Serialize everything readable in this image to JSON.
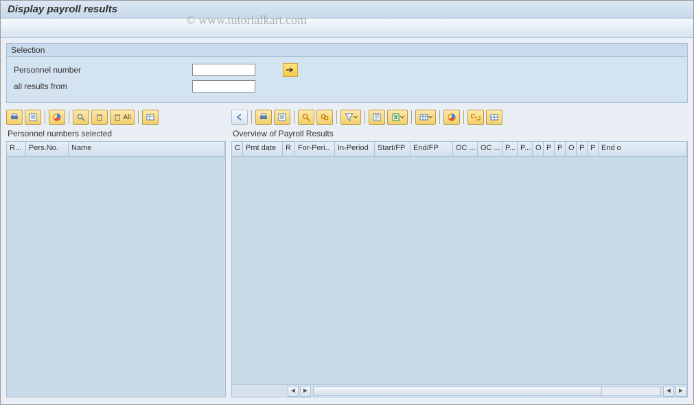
{
  "title": "Display payroll results",
  "watermark": "© www.tutorialkart.com",
  "selection": {
    "group_title": "Selection",
    "personnel_number_label": "Personnel number",
    "personnel_number_value": "",
    "all_results_from_label": "all results from",
    "all_results_from_value": ""
  },
  "left_panel": {
    "title": "Personnel numbers selected",
    "toolbar": {
      "print": "print-icon",
      "export": "export-icon",
      "chart": "chart-icon",
      "find": "find-icon",
      "delete": "delete-icon",
      "delete_all_label": "All",
      "layout": "layout-icon"
    },
    "columns": [
      "R...",
      "Pers.No.",
      "Name"
    ]
  },
  "right_panel": {
    "title": "Overview of Payroll Results",
    "toolbar": {
      "back": "back-icon",
      "print": "print-icon",
      "export": "export-icon",
      "find": "find-icon",
      "findnext": "findnext-icon",
      "filter": "filter-icon",
      "sum": "sum-icon",
      "excel": "excel-icon",
      "layout": "layout-icon",
      "chart": "chart-icon",
      "link": "link-icon",
      "grid": "grid-icon"
    },
    "columns": [
      "C",
      "Pmt date",
      "R",
      "For-Peri..",
      "In-Period",
      "Start/FP",
      "End/FP",
      "OC ...",
      "OC ...",
      "P...",
      "P...",
      "O",
      "P",
      "P",
      "O",
      "P",
      "P",
      "End o"
    ]
  }
}
